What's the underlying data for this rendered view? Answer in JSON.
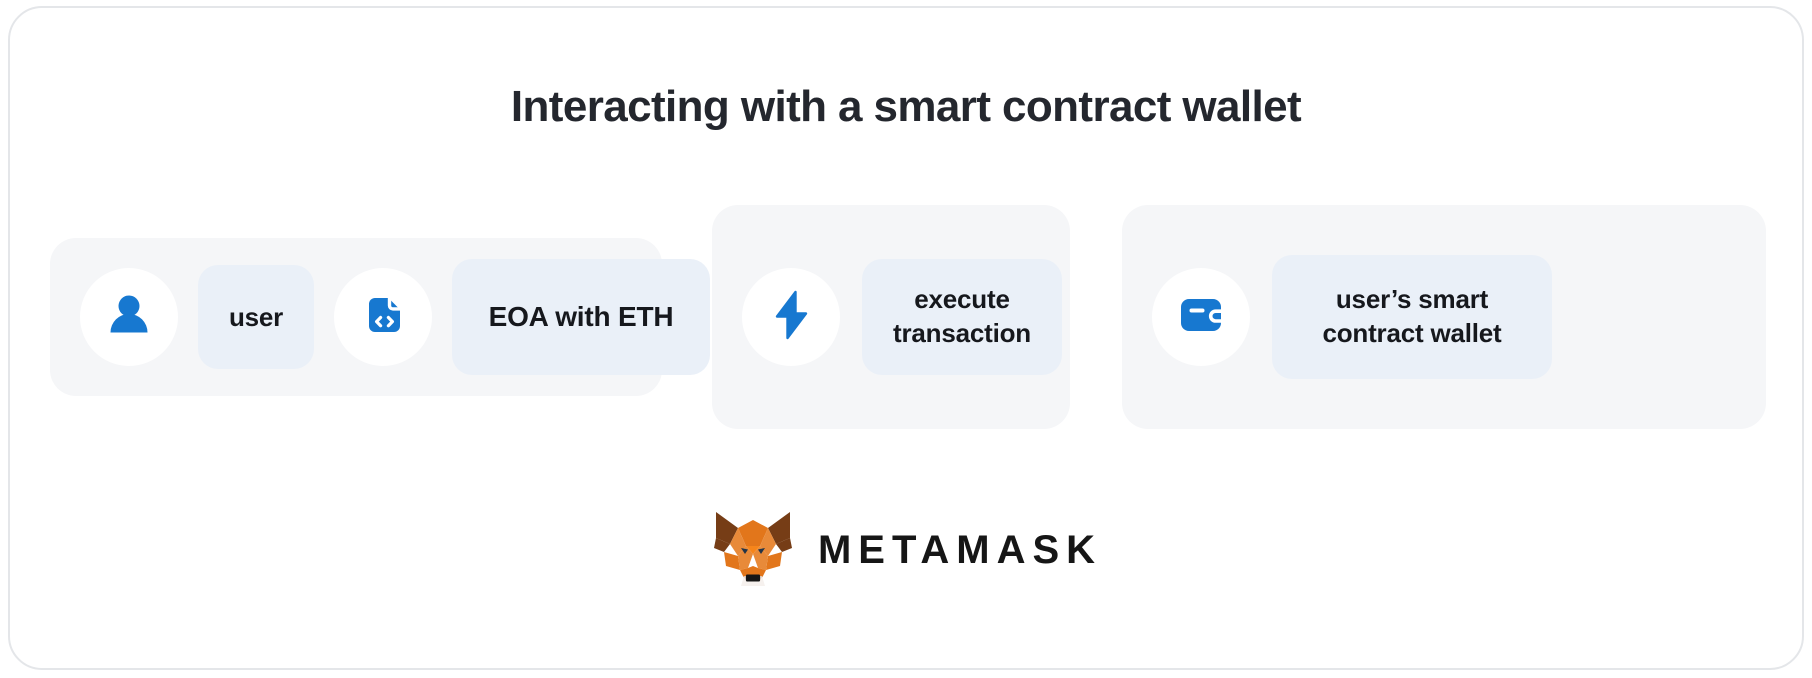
{
  "page": {
    "title": "Interacting with a smart contract wallet",
    "background_color": "#ffffff",
    "accent_color": "#1778d0",
    "title_color": "#24272e",
    "group_background": "#f5f6f8",
    "pill_background": "#eaf0f8"
  },
  "diagram": {
    "type": "flow",
    "groups": [
      {
        "id": "eoa",
        "nodes": [
          {
            "kind": "icon",
            "icon": "person-icon"
          },
          {
            "kind": "label",
            "text": "user"
          },
          {
            "kind": "icon",
            "icon": "smart-contract-code-icon"
          },
          {
            "kind": "label",
            "text": "EOA with ETH"
          }
        ]
      },
      {
        "id": "execute",
        "nodes": [
          {
            "kind": "icon",
            "icon": "lightning-bolt-icon"
          },
          {
            "kind": "label",
            "text_line1": "execute",
            "text_line2": "transaction"
          }
        ]
      },
      {
        "id": "wallet",
        "nodes": [
          {
            "kind": "icon",
            "icon": "wallet-icon"
          },
          {
            "kind": "label",
            "text_line1": "user’s smart",
            "text_line2": "contract wallet"
          }
        ]
      }
    ],
    "connectors": [
      {
        "id": "connector-1",
        "style": "dashed",
        "color": "#1778d0",
        "dashes": 3
      },
      {
        "id": "connector-2",
        "style": "dashed",
        "color": "#1778d0",
        "dashes": 3
      }
    ]
  },
  "brand": {
    "name": "METAMASK",
    "logo_icon": "metamask-fox-logo",
    "colors": {
      "fox_light": "#e88a39",
      "fox_mid": "#e2761b",
      "fox_dark": "#763d16",
      "fox_darker": "#8f5a30",
      "snout": "#d7c1b3",
      "snout_light": "#f6f1ee",
      "nose": "#161616",
      "eye": "#233447",
      "wordmark": "#161616"
    }
  }
}
